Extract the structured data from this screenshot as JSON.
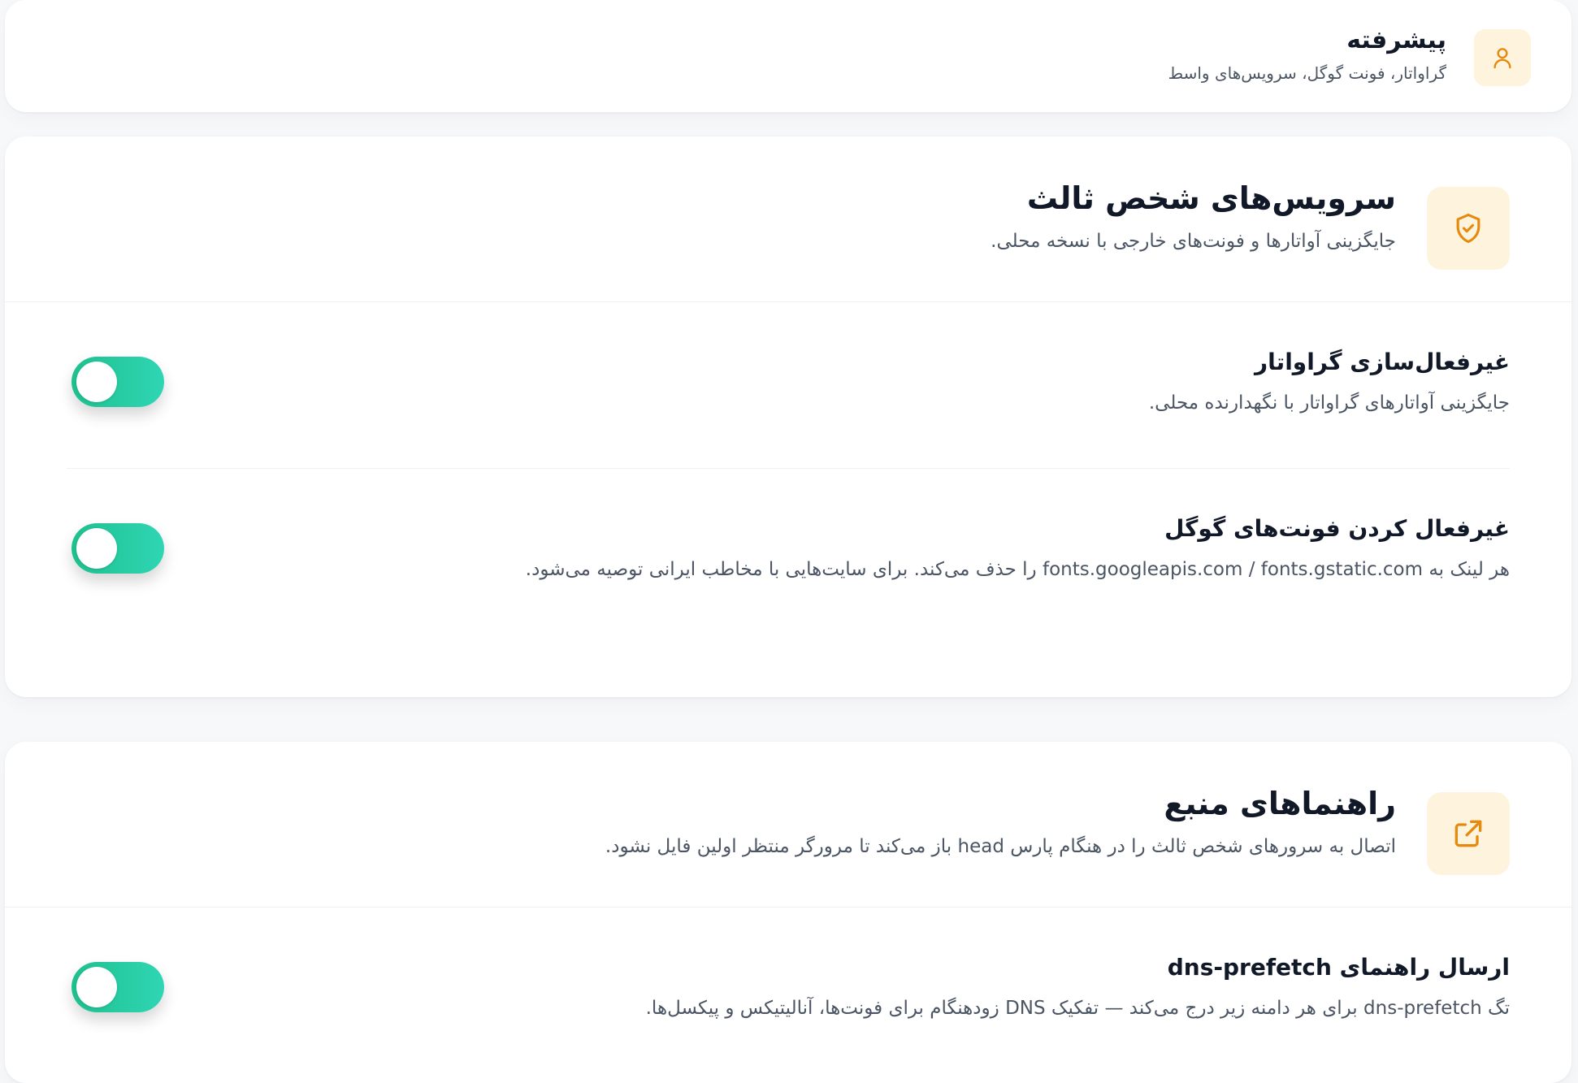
{
  "header": {
    "title": "پیشرفته",
    "subtitle": "گراواتار، فونت گوگل، سرویس‌های واسط",
    "icon": "user-icon"
  },
  "third_party": {
    "title": "سرویس‌های شخص ثالث",
    "subtitle": "جایگزینی آواتارها و فونت‌های خارجی با نسخه محلی.",
    "icon": "shield-check-icon",
    "items": [
      {
        "title": "غیرفعال‌سازی گراواتار",
        "description": "جایگزینی آواتارهای گراواتار با نگهدارنده محلی.",
        "enabled": true
      },
      {
        "title": "غیرفعال کردن فونت‌های گوگل",
        "description": "هر لینک به fonts.googleapis.com / fonts.gstatic.com را حذف می‌کند. برای سایت‌هایی با مخاطب ایرانی توصیه می‌شود.",
        "enabled": true
      }
    ]
  },
  "resource_hints": {
    "title": "راهنماهای منبع",
    "subtitle": "اتصال به سرورهای شخص ثالث را در هنگام پارس head باز می‌کند تا مرورگر منتظر اولین فایل نشود.",
    "icon": "external-link-icon",
    "items": [
      {
        "title": "ارسال راهنمای dns-prefetch",
        "description": "تگ dns-prefetch برای هر دامنه زیر درج می‌کند — تفکیک DNS زودهنگام برای فونت‌ها، آنالیتیکس و پیکسل‌ها.",
        "enabled": true
      }
    ]
  },
  "colors": {
    "accent": "#e58a0c",
    "icon_bg": "#fef3dc",
    "toggle_on_start": "#1fc08e",
    "toggle_on_end": "#2fd6b4"
  }
}
